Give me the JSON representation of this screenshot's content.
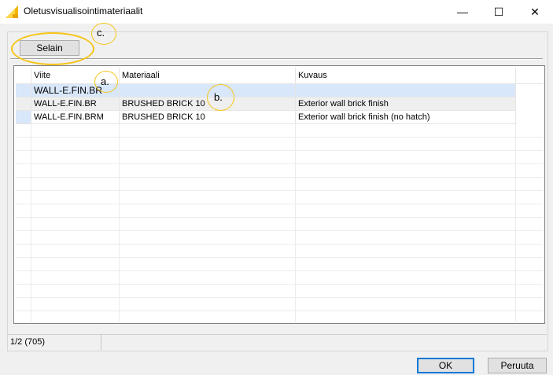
{
  "window": {
    "title": "Oletusvisualisointimateriaalit",
    "minimize_glyph": "—",
    "maximize_glyph": "☐",
    "close_glyph": "✕"
  },
  "toolbar": {
    "browse_label": "Selain"
  },
  "table": {
    "columns": [
      "Viite",
      "Materiaali",
      "Kuvaus"
    ],
    "rows": [
      {
        "viite": "WALL-E.FIN.BR",
        "materiaali": "",
        "kuvaus": ""
      },
      {
        "viite": "WALL-E.FIN.BR",
        "materiaali": "BRUSHED BRICK 10",
        "kuvaus": "Exterior wall brick finish"
      },
      {
        "viite": "WALL-E.FIN.BRM",
        "materiaali": "BRUSHED BRICK 10",
        "kuvaus": "Exterior wall brick finish (no hatch)"
      }
    ]
  },
  "status": {
    "text": "1/2 (705)"
  },
  "buttons": {
    "ok": "OK",
    "cancel": "Peruuta"
  },
  "callouts": {
    "a": "a.",
    "b": "b.",
    "c": "c."
  },
  "colors": {
    "callout": "#f5c518",
    "selection": "#d9e7fa",
    "ok_border": "#0078d7"
  }
}
